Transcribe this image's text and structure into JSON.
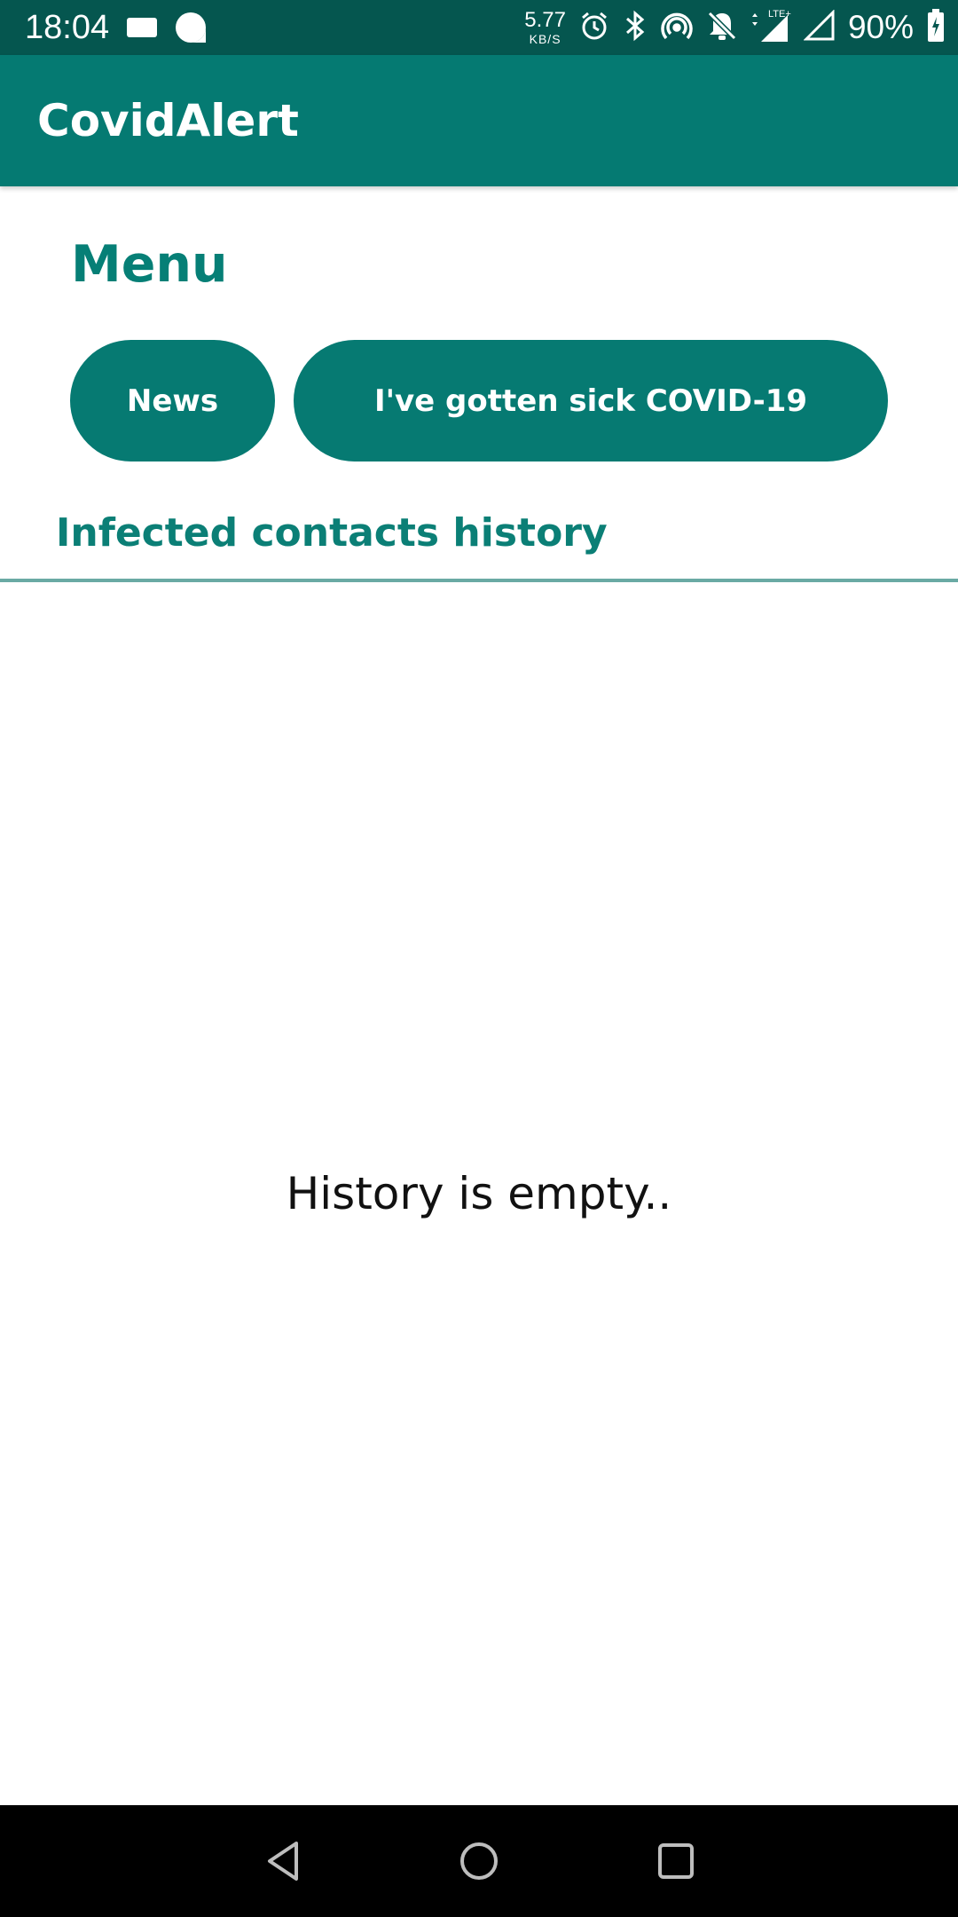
{
  "status_bar": {
    "time": "18:04",
    "net_speed_value": "5.77",
    "net_speed_unit": "KB/S",
    "network_type": "LTE+",
    "battery": "90%",
    "icons": [
      "message-icon",
      "notification-icon",
      "alarm-icon",
      "bluetooth-icon",
      "hotspot-icon",
      "mute-icon",
      "signal-icon",
      "signal-empty-icon",
      "battery-charging-icon"
    ]
  },
  "app_bar": {
    "title": "CovidAlert"
  },
  "menu": {
    "heading": "Menu",
    "news_label": "News",
    "sick_label": "I've gotten sick COVID-19"
  },
  "history": {
    "heading": "Infected contacts history",
    "empty_text": "History is empty.."
  },
  "nav_bar": {
    "icons": [
      "back-icon",
      "home-icon",
      "recents-icon"
    ]
  },
  "colors": {
    "status_bar": "#05564f",
    "app_bar": "#057a72",
    "accent": "#067f76",
    "divider": "#6aaaa4",
    "nav_bar": "#000000"
  }
}
